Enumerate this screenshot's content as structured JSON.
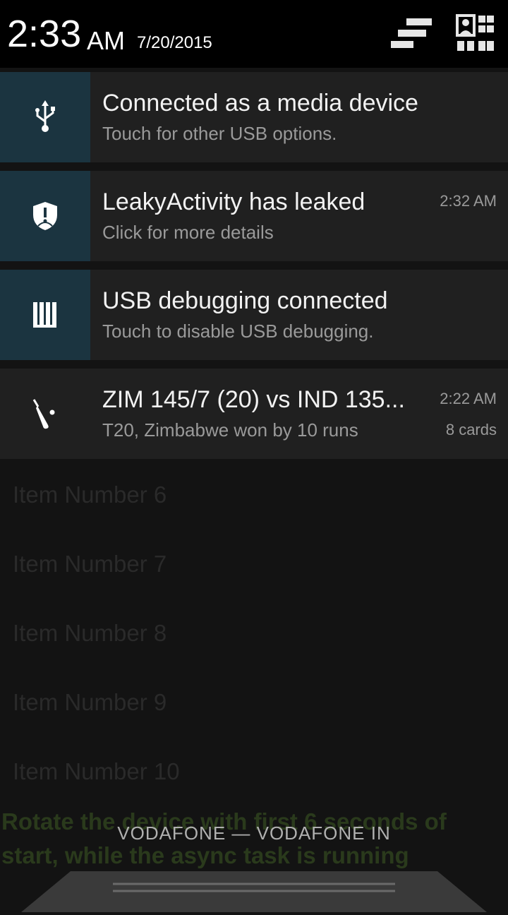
{
  "header": {
    "time": "2:33",
    "ampm": "AM",
    "date": "7/20/2015",
    "icons": [
      "settings-toggle-icon",
      "quick-settings-user-icon"
    ]
  },
  "notifications": [
    {
      "icon": "usb-icon",
      "title": "Connected as a media device",
      "subtitle": "Touch for other USB options.",
      "time": "",
      "count": ""
    },
    {
      "icon": "leak-shield-icon",
      "title": "LeakyActivity has leaked",
      "subtitle": "Click for more details",
      "time": "2:32 AM",
      "count": ""
    },
    {
      "icon": "usb-debugging-icon",
      "title": "USB debugging connected",
      "subtitle": "Touch to disable USB debugging.",
      "time": "",
      "count": ""
    },
    {
      "icon": "cricket-bat-icon",
      "title": "ZIM 145/7 (20) vs IND 135...",
      "subtitle": "T20, Zimbabwe won by 10 runs",
      "time": "2:22 AM",
      "count": "8 cards"
    }
  ],
  "background_list": [
    "Item Number 6",
    "Item Number 7",
    "Item Number 8",
    "Item Number 9",
    "Item Number 10"
  ],
  "background_hint": "Rotate the device with first 6 seconds of start, while the async task is running",
  "carrier": "VODAFONE — VODAFONE IN",
  "colors": {
    "accent_icon_bg": "#1b3440",
    "card_bg": "#202020",
    "header_bg": "#000000"
  }
}
